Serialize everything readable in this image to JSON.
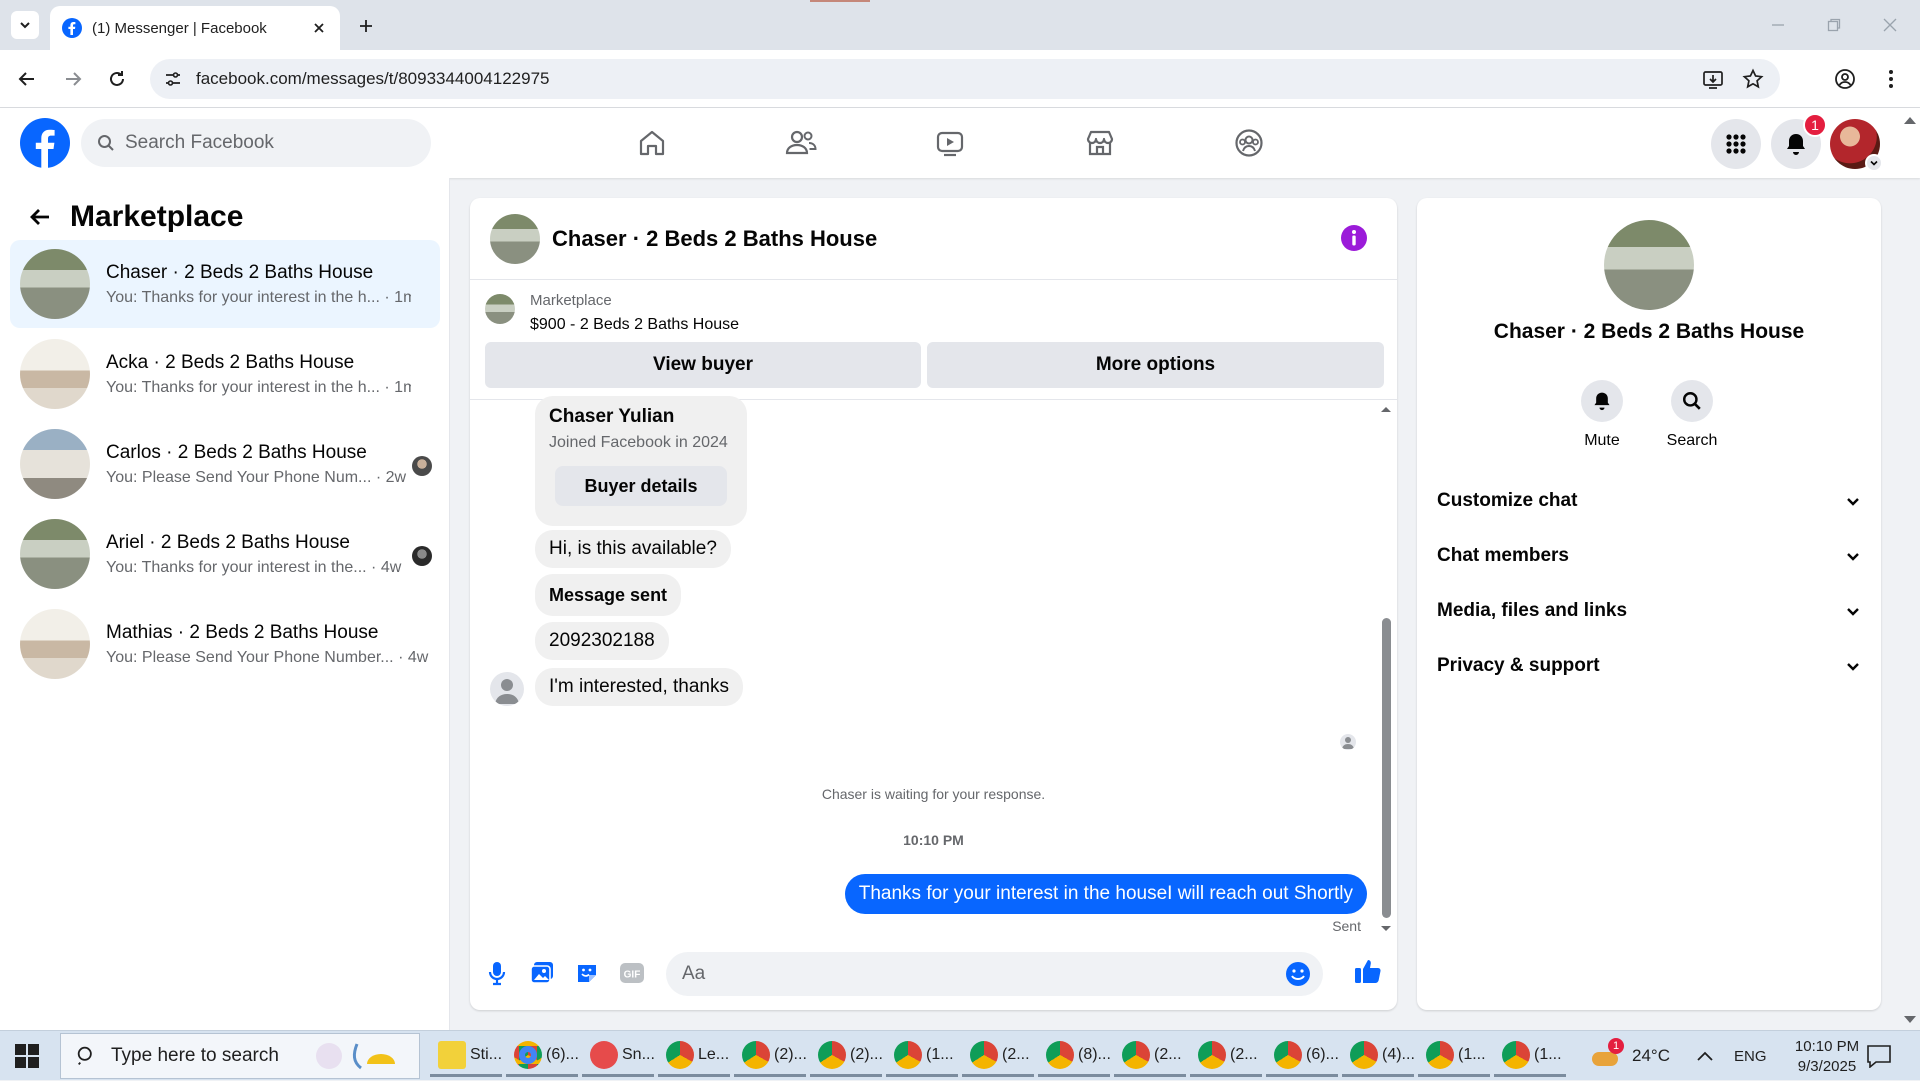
{
  "browser": {
    "tab_title": "(1) Messenger | Facebook",
    "url": "facebook.com/messages/t/8093344004122975"
  },
  "fb_header": {
    "search_placeholder": "Search Facebook",
    "notification_count": "1"
  },
  "left_panel": {
    "title": "Marketplace",
    "conversations": [
      {
        "name": "Chaser · 2 Beds 2 Baths House",
        "preview": "You: Thanks for your interest in the h...",
        "time": "· 1m",
        "active": true
      },
      {
        "name": "Acka · 2 Beds 2 Baths House",
        "preview": "You: Thanks for your interest in the h...",
        "time": "· 1m",
        "active": false
      },
      {
        "name": "Carlos · 2 Beds 2 Baths House",
        "preview": "You: Please Send Your Phone Num...",
        "time": "· 2w",
        "active": false
      },
      {
        "name": "Ariel · 2 Beds 2 Baths House",
        "preview": "You: Thanks for your interest in the...",
        "time": "· 4w",
        "active": false
      },
      {
        "name": "Mathias · 2 Beds 2 Baths House",
        "preview": "You: Please Send Your Phone Number...",
        "time": "· 4w",
        "active": false
      }
    ]
  },
  "chat": {
    "title": "Chaser · 2 Beds 2 Baths House",
    "marketplace_label": "Marketplace",
    "listing": "$900 - 2 Beds 2 Baths House",
    "view_buyer_label": "View buyer",
    "more_options_label": "More options",
    "buyer_name": "Chaser Yulian",
    "buyer_joined": "Joined Facebook in 2024",
    "buyer_details_label": "Buyer details",
    "messages_in": [
      "Hi, is this available?",
      "Message sent",
      "2092302188",
      "I'm interested, thanks"
    ],
    "waiting_text": "Chaser is waiting for your response.",
    "timestamp": "10:10 PM",
    "message_out": "Thanks for your interest in the houseI will reach out Shortly",
    "sent_label": "Sent",
    "composer_placeholder": "Aa"
  },
  "right_panel": {
    "name": "Chaser · 2 Beds 2 Baths House",
    "mute_label": "Mute",
    "search_label": "Search",
    "sections": [
      "Customize chat",
      "Chat members",
      "Media, files and links",
      "Privacy & support"
    ]
  },
  "taskbar": {
    "search_text": "Type here to search",
    "apps": [
      "Sti...",
      "(6)...",
      "Sn...",
      "Le...",
      "(2)...",
      "(2)...",
      "(1...",
      "(2...",
      "(8)...",
      "(2...",
      "(2...",
      "(6)...",
      "(4)...",
      "(1...",
      "(1..."
    ],
    "weather_badge": "1",
    "temperature": "24°C",
    "language": "ENG",
    "time": "10:10 PM",
    "date": "9/3/2025"
  },
  "colors": {
    "fb_blue": "#0866ff",
    "purple_info": "#9b1bd9",
    "badge_red": "#e41e3f",
    "active_row": "#ebf5ff"
  }
}
